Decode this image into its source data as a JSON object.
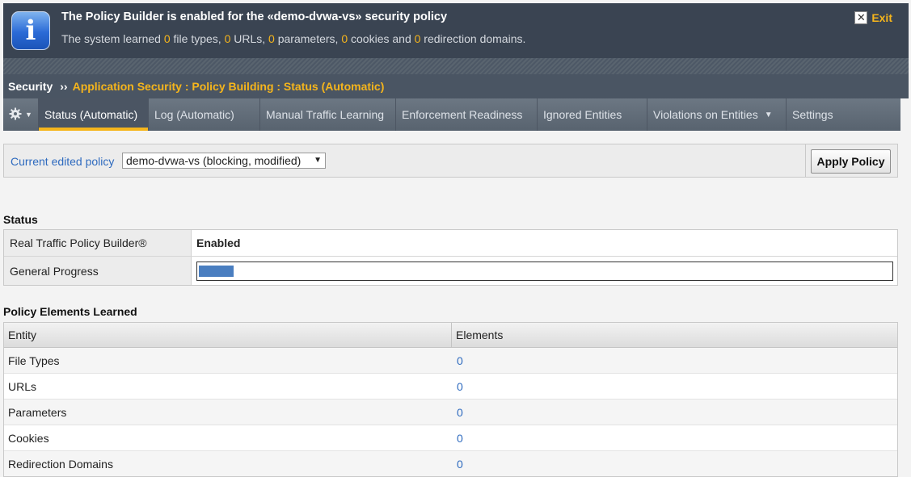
{
  "banner": {
    "title": "The Policy Builder is enabled for the «demo-dvwa-vs» security policy",
    "message_parts": {
      "p1": "The system learned ",
      "n1": "0",
      "p2": " file types, ",
      "n2": "0",
      "p3": " URLs, ",
      "n3": "0",
      "p4": " parameters, ",
      "n4": "0",
      "p5": " cookies and ",
      "n5": "0",
      "p6": " redirection domains."
    },
    "exit_label": "Exit",
    "colors": {
      "background": "#3a4452",
      "highlight": "#f5b51c"
    }
  },
  "breadcrumb": {
    "root": "Security",
    "separator": "››",
    "path": "Application Security : Policy Building : Status (Automatic)"
  },
  "tabs": [
    {
      "label": "Status (Automatic)",
      "active": true
    },
    {
      "label": "Log (Automatic)"
    },
    {
      "label": "Manual Traffic Learning"
    },
    {
      "label": "Enforcement Readiness"
    },
    {
      "label": "Ignored Entities"
    },
    {
      "label": "Violations on Entities",
      "has_dropdown": true
    },
    {
      "label": "Settings"
    }
  ],
  "policy_selector": {
    "label": "Current edited policy",
    "selected": "demo-dvwa-vs (blocking, modified)",
    "apply_label": "Apply Policy"
  },
  "status": {
    "title": "Status",
    "rows": [
      {
        "key": "Real Traffic Policy Builder®",
        "value": "Enabled"
      },
      {
        "key": "General Progress",
        "progress_fraction": 0.05
      }
    ]
  },
  "learned": {
    "title": "Policy Elements Learned",
    "columns": [
      "Entity",
      "Elements"
    ],
    "rows": [
      {
        "entity": "File Types",
        "elements": "0"
      },
      {
        "entity": "URLs",
        "elements": "0"
      },
      {
        "entity": "Parameters",
        "elements": "0"
      },
      {
        "entity": "Cookies",
        "elements": "0"
      },
      {
        "entity": "Redirection Domains",
        "elements": "0"
      }
    ]
  }
}
